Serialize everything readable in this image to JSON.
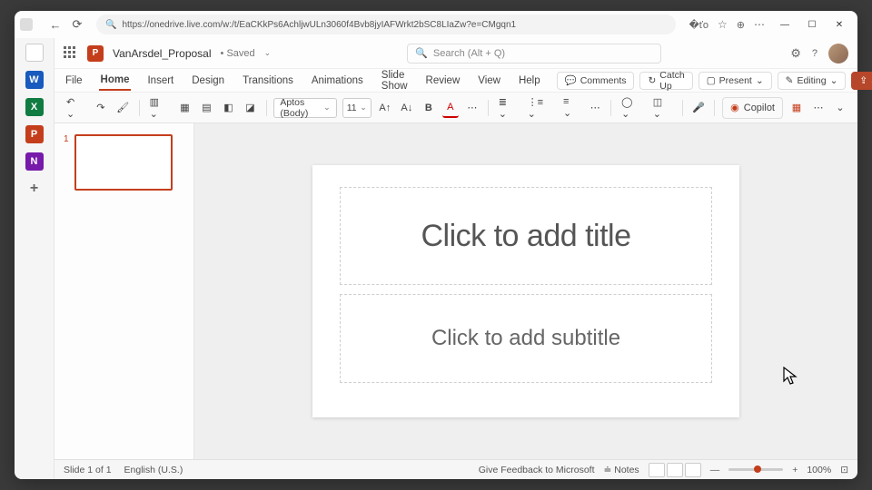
{
  "browser": {
    "url": "https://onedrive.live.com/w:/t/EaCKkPs6AchljwULn3060f4Bvb8jyIAFWrkt2bSC8LIaZw?e=CMgqn1"
  },
  "header": {
    "doc_name": "VanArsdel_Proposal",
    "saved": "Saved",
    "search_placeholder": "Search (Alt + Q)"
  },
  "ribbon": {
    "tabs": [
      "File",
      "Home",
      "Insert",
      "Design",
      "Transitions",
      "Animations",
      "Slide Show",
      "Review",
      "View",
      "Help"
    ],
    "active": "Home",
    "comments": "Comments",
    "catchup": "Catch Up",
    "present": "Present",
    "editing": "Editing",
    "share": "Share"
  },
  "toolbar": {
    "font": "Aptos (Body)",
    "size": "11",
    "copilot": "Copilot"
  },
  "thumbs": {
    "num1": "1"
  },
  "slide": {
    "title_ph": "Click to add title",
    "subtitle_ph": "Click to add subtitle"
  },
  "status": {
    "slide": "Slide 1 of 1",
    "lang": "English (U.S.)",
    "feedback": "Give Feedback to Microsoft",
    "notes": "Notes",
    "zoom": "100%"
  }
}
